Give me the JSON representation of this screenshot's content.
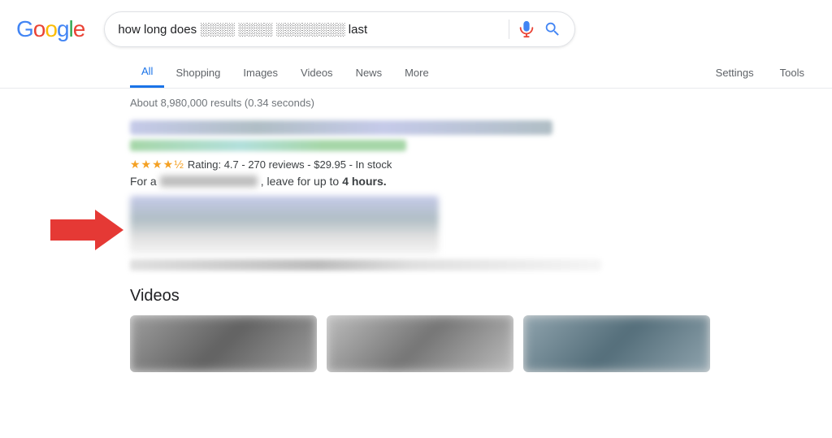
{
  "logo": {
    "g": "G",
    "o1": "o",
    "o2": "o",
    "g2": "g",
    "l": "l",
    "e": "e"
  },
  "search": {
    "query": "how long does ████ ████ ████████ last",
    "placeholder": "Search"
  },
  "nav": {
    "tabs": [
      {
        "id": "all",
        "label": "All",
        "active": true
      },
      {
        "id": "shopping",
        "label": "Shopping",
        "active": false
      },
      {
        "id": "images",
        "label": "Images",
        "active": false
      },
      {
        "id": "videos",
        "label": "Videos",
        "active": false
      },
      {
        "id": "news",
        "label": "News",
        "active": false
      },
      {
        "id": "more",
        "label": "More",
        "active": false
      }
    ],
    "right_tabs": [
      {
        "id": "settings",
        "label": "Settings"
      },
      {
        "id": "tools",
        "label": "Tools"
      }
    ]
  },
  "results": {
    "count_text": "About 8,980,000 results (0.34 seconds)",
    "rating_text": "Rating: 4.7 - 270 reviews - $29.95 - In stock",
    "description_prefix": "For a",
    "description_suffix": ", leave for up to",
    "description_bold": "4 hours.",
    "videos_heading": "Videos"
  }
}
